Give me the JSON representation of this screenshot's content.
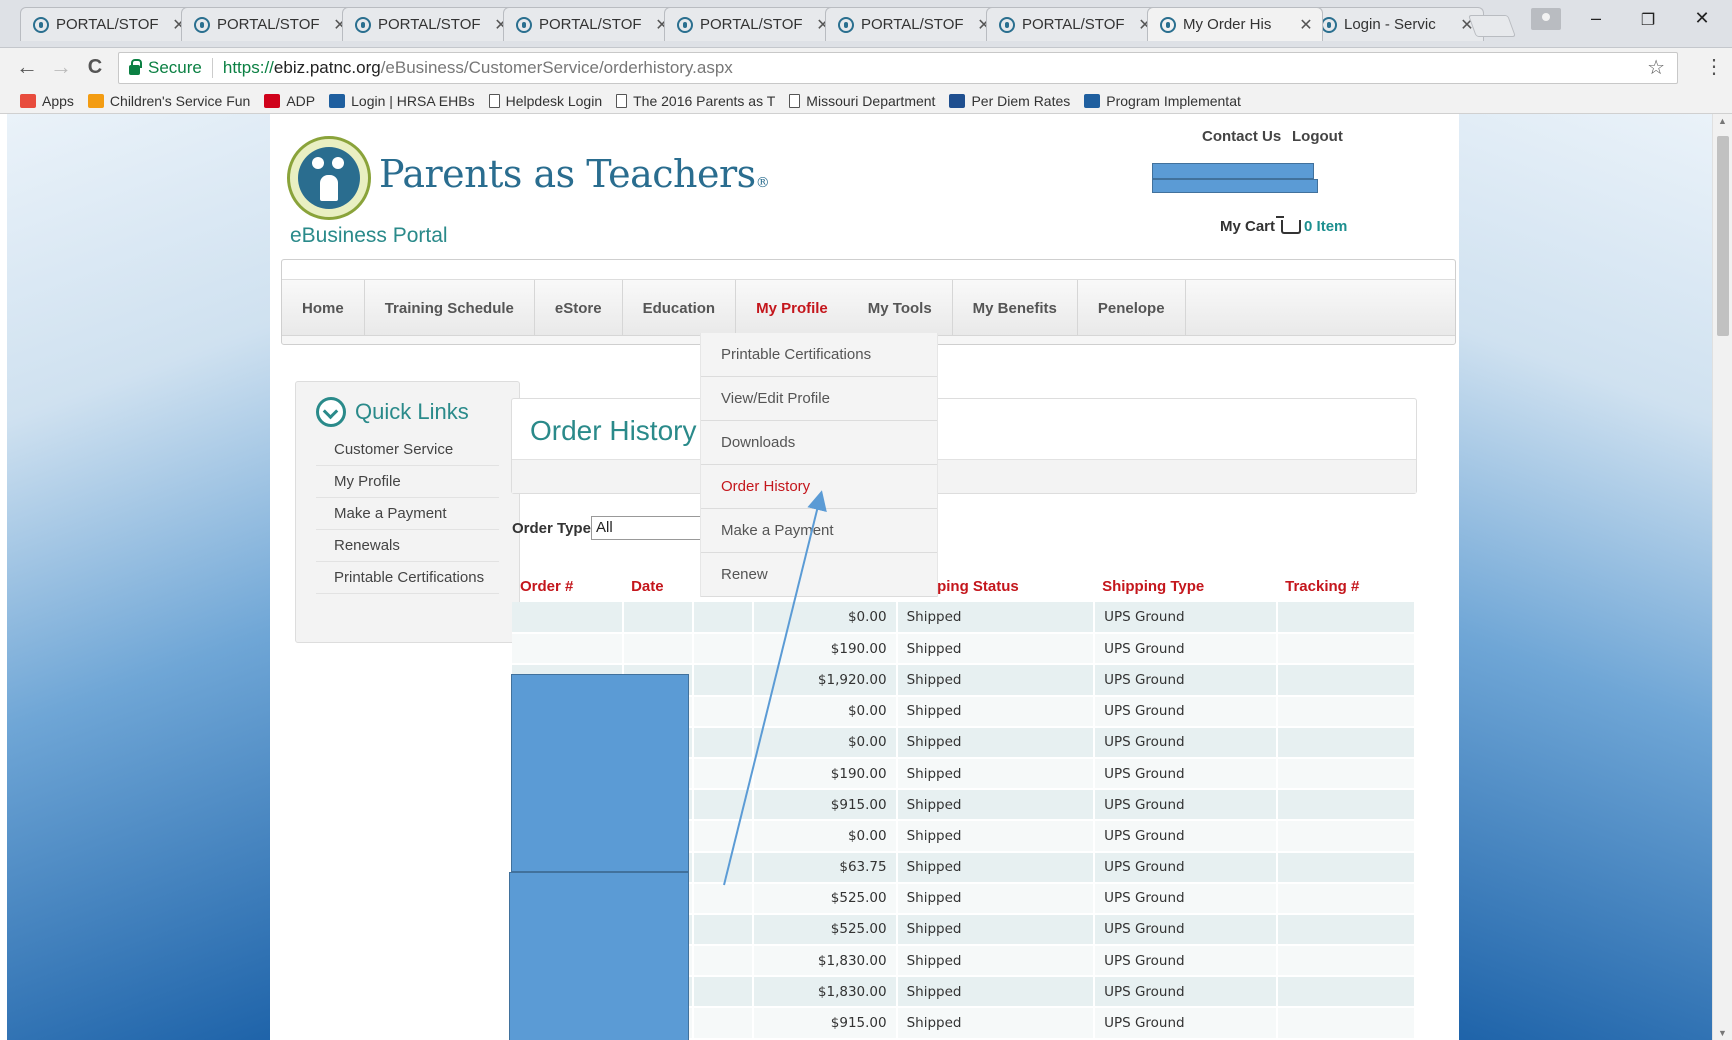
{
  "browser": {
    "tabs": [
      {
        "title": "PORTAL/STOF"
      },
      {
        "title": "PORTAL/STOF"
      },
      {
        "title": "PORTAL/STOF"
      },
      {
        "title": "PORTAL/STOF"
      },
      {
        "title": "PORTAL/STOF"
      },
      {
        "title": "PORTAL/STOF"
      },
      {
        "title": "PORTAL/STOF"
      },
      {
        "title": "My Order His"
      },
      {
        "title": "Login - Servic"
      }
    ],
    "close_glyph": "✕",
    "window_controls": {
      "minimize": "–",
      "restore": "❐",
      "close": "✕"
    },
    "nav": {
      "back": "←",
      "forward": "→",
      "reload": "C"
    },
    "secure_label": "Secure",
    "url": {
      "scheme": "https://",
      "host": "ebiz.patnc.org",
      "path": "/eBusiness/CustomerService/orderhistory.aspx"
    },
    "star_glyph": "☆",
    "menu_glyph": "⋮",
    "bookmarks": [
      {
        "label": "Apps",
        "icon": "apps-grid-icon",
        "color": "#e84c3d"
      },
      {
        "label": "Children's Service Fun",
        "icon": "heart-icon",
        "color": "#f39c12"
      },
      {
        "label": "ADP",
        "icon": "adp-logo-icon",
        "color": "#d0021b"
      },
      {
        "label": "Login | HRSA EHBs",
        "icon": "ehb-icon",
        "color": "#1f5f9f"
      },
      {
        "label": "Helpdesk Login",
        "icon": "page-icon",
        "color": "#555555"
      },
      {
        "label": "The 2016 Parents as T",
        "icon": "page-icon",
        "color": "#555555"
      },
      {
        "label": "Missouri Department",
        "icon": "page-icon",
        "color": "#555555"
      },
      {
        "label": "Per Diem Rates",
        "icon": "gsa-icon",
        "color": "#1f4f8f"
      },
      {
        "label": "Program Implementat",
        "icon": "hr-icon",
        "color": "#1f5f9f"
      }
    ]
  },
  "site": {
    "brand_name": "Parents as Teachers",
    "brand_mark": "®",
    "portal_title": "eBusiness Portal",
    "header_links": {
      "contact": "Contact Us",
      "logout": "Logout"
    },
    "cart": {
      "label": "My Cart",
      "count": "0 Item"
    },
    "nav": [
      {
        "label": "Home",
        "active": false
      },
      {
        "label": "Training Schedule",
        "active": false
      },
      {
        "label": "eStore",
        "active": false
      },
      {
        "label": "Education",
        "active": false
      },
      {
        "label": "My Profile",
        "active": true
      },
      {
        "label": "My Tools",
        "active": false
      },
      {
        "label": "My Benefits",
        "active": false
      },
      {
        "label": "Penelope",
        "active": false
      }
    ],
    "profile_menu": [
      {
        "label": "Printable Certifications"
      },
      {
        "label": "View/Edit Profile"
      },
      {
        "label": "Downloads"
      },
      {
        "label": "Order History",
        "current": true
      },
      {
        "label": "Make a Payment"
      },
      {
        "label": "Renew"
      }
    ],
    "quick_links": {
      "title": "Quick Links",
      "items": [
        "Customer Service",
        "My Profile",
        "Make a Payment",
        "Renewals",
        "Printable Certifications"
      ]
    },
    "order_history": {
      "title": "Order History",
      "order_type_label": "Order Type",
      "order_type_value": "All",
      "columns": [
        "Order #",
        "Date",
        "",
        "",
        "Shipping Status",
        "Shipping Type",
        "Tracking #"
      ],
      "rows": [
        {
          "amount": "$0.00",
          "status": "Shipped",
          "type": "UPS Ground"
        },
        {
          "amount": "$190.00",
          "status": "Shipped",
          "type": "UPS Ground"
        },
        {
          "amount": "$1,920.00",
          "status": "Shipped",
          "type": "UPS Ground"
        },
        {
          "amount": "$0.00",
          "status": "Shipped",
          "type": "UPS Ground"
        },
        {
          "amount": "$0.00",
          "status": "Shipped",
          "type": "UPS Ground"
        },
        {
          "amount": "$190.00",
          "status": "Shipped",
          "type": "UPS Ground"
        },
        {
          "amount": "$915.00",
          "status": "Shipped",
          "type": "UPS Ground"
        },
        {
          "amount": "$0.00",
          "status": "Shipped",
          "type": "UPS Ground"
        },
        {
          "amount": "$63.75",
          "status": "Shipped",
          "type": "UPS Ground"
        },
        {
          "amount": "$525.00",
          "status": "Shipped",
          "type": "UPS Ground"
        },
        {
          "amount": "$525.00",
          "status": "Shipped",
          "type": "UPS Ground"
        },
        {
          "amount": "$1,830.00",
          "status": "Shipped",
          "type": "UPS Ground"
        },
        {
          "amount": "$1,830.00",
          "status": "Shipped",
          "type": "UPS Ground"
        },
        {
          "amount": "$915.00",
          "status": "Shipped",
          "type": "UPS Ground"
        }
      ]
    },
    "colors": {
      "accent_red": "#c4161c",
      "teal": "#2a8a8a",
      "redaction": "#5b9bd5",
      "brand_blue": "#2a6d8f"
    }
  }
}
